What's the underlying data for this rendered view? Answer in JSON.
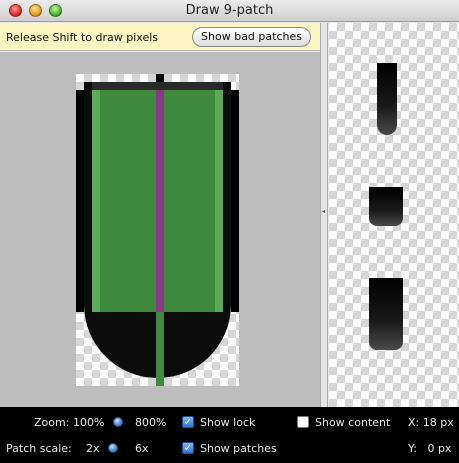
{
  "window": {
    "title": "Draw 9-patch"
  },
  "status": {
    "message": "Release Shift to draw pixels",
    "bad_patches_label": "Show bad patches"
  },
  "toolbar": {
    "zoom": {
      "label": "Zoom:",
      "min": "100%",
      "max": "800%",
      "value_fraction": 0.0
    },
    "patch_scale": {
      "label": "Patch scale:",
      "min": "2x",
      "max": "6x",
      "value_fraction": 0.0
    },
    "show_lock": {
      "label": "Show lock",
      "checked": true
    },
    "show_patches": {
      "label": "Show patches",
      "checked": true
    },
    "show_content": {
      "label": "Show content",
      "checked": false
    },
    "coord_x": "X: 18 px",
    "coord_y": "Y:   0 px"
  },
  "colors": {
    "patch_green": "#3f8a3c",
    "patch_green_light": "#5bab58",
    "patch_magenta": "#8a3a86",
    "status_bg": "#fdf6c2",
    "editor_bg": "#bdbdbd"
  }
}
